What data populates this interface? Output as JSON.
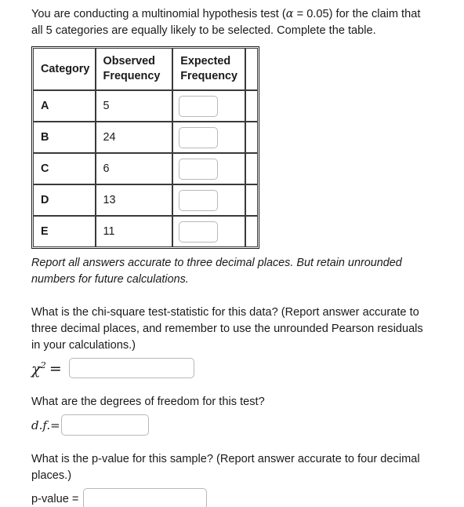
{
  "intro": {
    "line1_before_alpha": "You are conducting a multinomial hypothesis test (",
    "alpha_symbol": "α",
    "line1_after_alpha": " = 0.05) for the claim that all 5 categories are equally likely to be selected. Complete the table."
  },
  "table": {
    "headers": {
      "category": "Category",
      "observed": "Observed Frequency",
      "expected": "Expected Frequency"
    },
    "rows": [
      {
        "category": "A",
        "observed": "5",
        "expected_value": "",
        "expected_placeholder": ""
      },
      {
        "category": "B",
        "observed": "24",
        "expected_value": "",
        "expected_placeholder": ""
      },
      {
        "category": "C",
        "observed": "6",
        "expected_value": "",
        "expected_placeholder": ""
      },
      {
        "category": "D",
        "observed": "13",
        "expected_value": "",
        "expected_placeholder": ""
      },
      {
        "category": "E",
        "observed": "11",
        "expected_value": "",
        "expected_placeholder": ""
      }
    ]
  },
  "note": "Report all answers accurate to three decimal places. But retain unrounded numbers for future calculations.",
  "questions": {
    "chi_square": {
      "text": "What is the chi-square test-statistic for this data? (Report answer accurate to three decimal places, and remember to use the unrounded Pearson residuals in your calculations.)",
      "label_symbol": "χ",
      "label_exponent": "2",
      "label_equals": "=",
      "value": "",
      "placeholder": ""
    },
    "degrees_of_freedom": {
      "text": "What are the degrees of freedom for this test?",
      "label": "d.f.=",
      "value": "",
      "placeholder": ""
    },
    "p_value": {
      "text": "What is the p-value for this sample? (Report answer accurate to four decimal places.)",
      "label": "p-value =",
      "value": "",
      "placeholder": ""
    }
  }
}
